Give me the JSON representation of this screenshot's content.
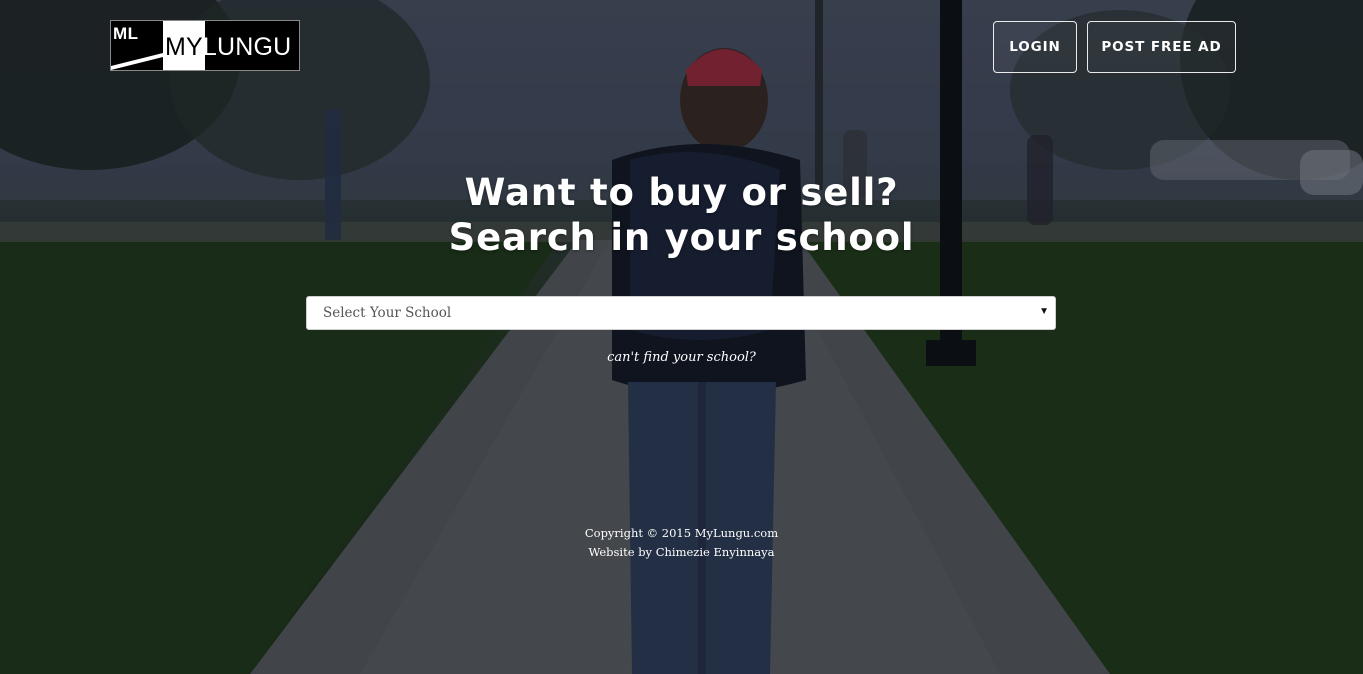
{
  "header": {
    "logo": {
      "short": "ML",
      "name_dark": "MY",
      "name_light": "LUNGU"
    },
    "nav": {
      "login_label": "LOGIN",
      "post_ad_label": "POST FREE AD"
    }
  },
  "hero": {
    "title_line1": "Want to buy or sell?",
    "title_line2": "Search in your school",
    "school_select": {
      "selected": "Select Your School",
      "icon": "caret-down-icon"
    },
    "cant_find_link": "can't find your school?"
  },
  "footer": {
    "copyright": "Copyright © 2015 MyLungu.com",
    "credit": "Website by Chimezie Enyinnaya"
  },
  "colors": {
    "button_border": "#ffffff",
    "select_background": "#ffffff",
    "text": "#ffffff"
  }
}
